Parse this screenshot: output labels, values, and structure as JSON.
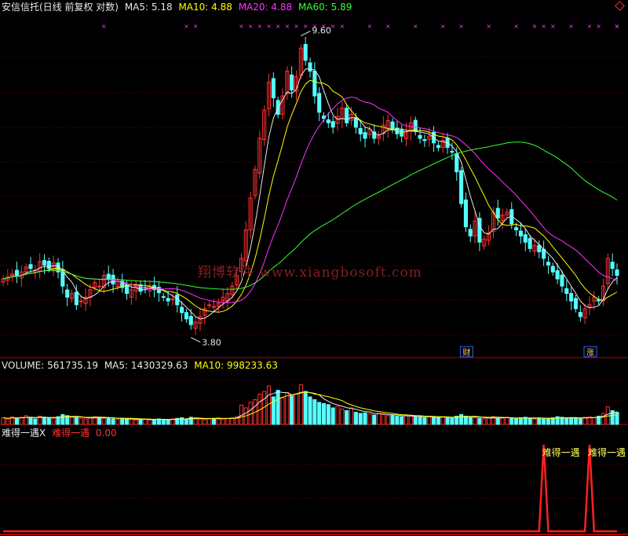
{
  "header": {
    "stock_name": "安信信托(日线 前复权 对数)",
    "ma5": "MA5: 5.18",
    "ma10": "MA10: 4.88",
    "ma20": "MA20: 4.88",
    "ma60": "MA60: 5.89"
  },
  "volume_header": {
    "volume": "VOLUME: 561735.19",
    "ma5": "MA5: 1430329.63",
    "ma10": "MA10: 998233.63"
  },
  "indicator_header": {
    "name": "难得一遇X",
    "series": "难得一遇",
    "value": "0.00"
  },
  "watermark": "翔博软件 www.xiangbosoft.com",
  "colors": {
    "up": "#ff3030",
    "down": "#54ffff",
    "ma5": "#e8e8e8",
    "ma10": "#ffff00",
    "ma20": "#ff33ff",
    "ma60": "#33ff33",
    "signal": "#ff2020",
    "grid": "#7a0000"
  },
  "chart_data": [
    {
      "type": "candlestick",
      "scale": "log",
      "annotations": [
        {
          "label": "9.60",
          "kind": "high"
        },
        {
          "label": "3.80",
          "kind": "low"
        },
        {
          "label": "财",
          "kind": "event-tag"
        },
        {
          "label": "涨",
          "kind": "event-tag"
        }
      ],
      "close": [
        4.45,
        4.48,
        4.52,
        4.5,
        4.55,
        4.62,
        4.6,
        4.58,
        4.7,
        4.65,
        4.6,
        4.68,
        4.55,
        4.35,
        4.2,
        4.25,
        4.1,
        4.15,
        4.2,
        4.3,
        4.4,
        4.35,
        4.5,
        4.45,
        4.38,
        4.42,
        4.33,
        4.25,
        4.3,
        4.35,
        4.28,
        4.32,
        4.36,
        4.3,
        4.26,
        4.2,
        4.15,
        4.18,
        4.1,
        4.0,
        3.92,
        3.85,
        3.88,
        3.95,
        4.05,
        4.1,
        4.08,
        4.12,
        4.2,
        4.25,
        4.35,
        4.5,
        4.75,
        5.2,
        5.75,
        6.3,
        6.95,
        7.6,
        8.3,
        7.9,
        7.5,
        7.95,
        8.6,
        8.1,
        8.45,
        9.25,
        8.9,
        8.6,
        7.95,
        7.55,
        7.4,
        7.3,
        7.2,
        7.45,
        7.65,
        7.3,
        7.5,
        7.2,
        7.05,
        6.95,
        7.15,
        6.95,
        7.0,
        7.25,
        7.35,
        7.15,
        7.05,
        7.0,
        7.1,
        7.3,
        7.1,
        6.95,
        6.9,
        7.0,
        6.85,
        6.75,
        6.9,
        6.75,
        6.65,
        6.25,
        5.65,
        5.25,
        5.1,
        5.35,
        5.0,
        5.05,
        5.15,
        5.5,
        5.4,
        5.45,
        5.5,
        5.3,
        5.2,
        5.1,
        5.0,
        4.9,
        4.95,
        4.85,
        4.75,
        4.65,
        4.55,
        4.45,
        4.35,
        4.25,
        4.15,
        4.05,
        3.95,
        4.05,
        4.1,
        4.2,
        4.15,
        4.35,
        4.75,
        4.6,
        4.5
      ],
      "ma_daily": [
        "MA5",
        "MA10",
        "MA20",
        "MA60"
      ],
      "ma_values": {
        "MA5": 5.18,
        "MA10": 4.88,
        "MA20": 4.88,
        "MA60": 5.89
      }
    },
    {
      "type": "bar",
      "title": "VOLUME",
      "values_relative": [
        0.12,
        0.1,
        0.14,
        0.11,
        0.13,
        0.16,
        0.12,
        0.1,
        0.15,
        0.13,
        0.12,
        0.11,
        0.14,
        0.18,
        0.16,
        0.13,
        0.12,
        0.11,
        0.1,
        0.12,
        0.14,
        0.13,
        0.11,
        0.12,
        0.1,
        0.09,
        0.11,
        0.1,
        0.09,
        0.08,
        0.09,
        0.1,
        0.08,
        0.09,
        0.1,
        0.09,
        0.08,
        0.1,
        0.11,
        0.12,
        0.1,
        0.13,
        0.12,
        0.1,
        0.09,
        0.1,
        0.11,
        0.12,
        0.1,
        0.11,
        0.12,
        0.14,
        0.35,
        0.3,
        0.4,
        0.45,
        0.55,
        0.6,
        0.7,
        0.5,
        0.62,
        0.48,
        0.58,
        0.52,
        0.55,
        0.72,
        0.6,
        0.5,
        0.45,
        0.4,
        0.38,
        0.36,
        0.3,
        0.33,
        0.28,
        0.25,
        0.3,
        0.22,
        0.2,
        0.21,
        0.19,
        0.17,
        0.2,
        0.18,
        0.16,
        0.17,
        0.15,
        0.14,
        0.16,
        0.15,
        0.14,
        0.13,
        0.12,
        0.15,
        0.13,
        0.12,
        0.14,
        0.12,
        0.11,
        0.15,
        0.18,
        0.15,
        0.13,
        0.12,
        0.11,
        0.1,
        0.12,
        0.14,
        0.11,
        0.12,
        0.13,
        0.11,
        0.1,
        0.12,
        0.13,
        0.11,
        0.1,
        0.12,
        0.11,
        0.1,
        0.12,
        0.14,
        0.13,
        0.12,
        0.11,
        0.12,
        0.11,
        0.13,
        0.14,
        0.12,
        0.15,
        0.2,
        0.32,
        0.25,
        0.22
      ],
      "legend": [
        "VOLUME",
        "MA5",
        "MA10"
      ],
      "values": {
        "VOLUME": 561735.19,
        "MA5": 1430329.63,
        "MA10": 998233.63
      }
    },
    {
      "type": "line",
      "title": "难得一遇X",
      "series": [
        {
          "name": "难得一遇",
          "signal_index": [
            118,
            128
          ]
        }
      ],
      "value": 0.0,
      "annotations": [
        "难得一遇",
        "难得一遇"
      ]
    }
  ]
}
